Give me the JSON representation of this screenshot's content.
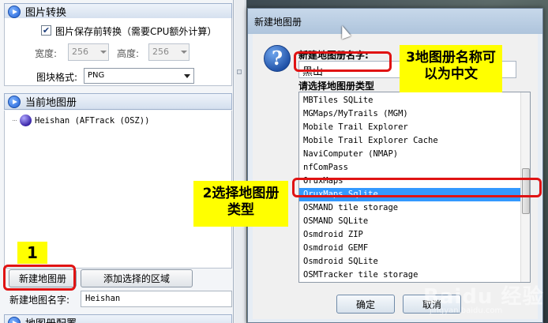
{
  "left_panel": {
    "image_section": {
      "title": "图片转换",
      "checkbox_label": "图片保存前转换（需要CPU额外计算）",
      "checked": true,
      "width_label": "宽度:",
      "width_value": "256",
      "height_label": "高度:",
      "height_value": "256",
      "format_label": "图块格式:",
      "format_value": "PNG"
    },
    "current_atlas": {
      "title": "当前地图册",
      "items": [
        "Heishan (AFTrack (OSZ))"
      ]
    },
    "new_atlas_button": "新建地图册",
    "add_selection_button": "添加选择的区域",
    "atlas_name_label": "新建地图名字:",
    "atlas_name_value": "Heishan",
    "bottom_section_title": "地图册配置"
  },
  "dialog": {
    "title": "新建地图册",
    "name_label": "新建地图册名字:",
    "name_value": "黑山",
    "type_label": "请选择地图册类型",
    "types": [
      "MBTiles SQLite",
      "MGMaps/MyTrails (MGM)",
      "Mobile Trail Explorer",
      "Mobile Trail Explorer Cache",
      "NaviComputer (NMAP)",
      "nfComPass",
      "OruxMaps",
      "OruxMaps Sqlite",
      "OSMAND tile storage",
      "OSMAND SQLite",
      "Osmdroid ZIP",
      "Osmdroid GEMF",
      "Osmdroid SQLite",
      "OSMTracker tile storage"
    ],
    "selected_type": "OruxMaps Sqlite",
    "ok_button": "确定",
    "cancel_button": "取消"
  },
  "annotations": {
    "step1": "1",
    "step2": "2选择地图册类型",
    "step3": "3地图册名称可以为中文",
    "highlight_color": "#ffff00",
    "frame_color": "#e01313"
  },
  "watermark": {
    "text": "Baidu 经验",
    "sub": "jingyan.baidu.com"
  }
}
